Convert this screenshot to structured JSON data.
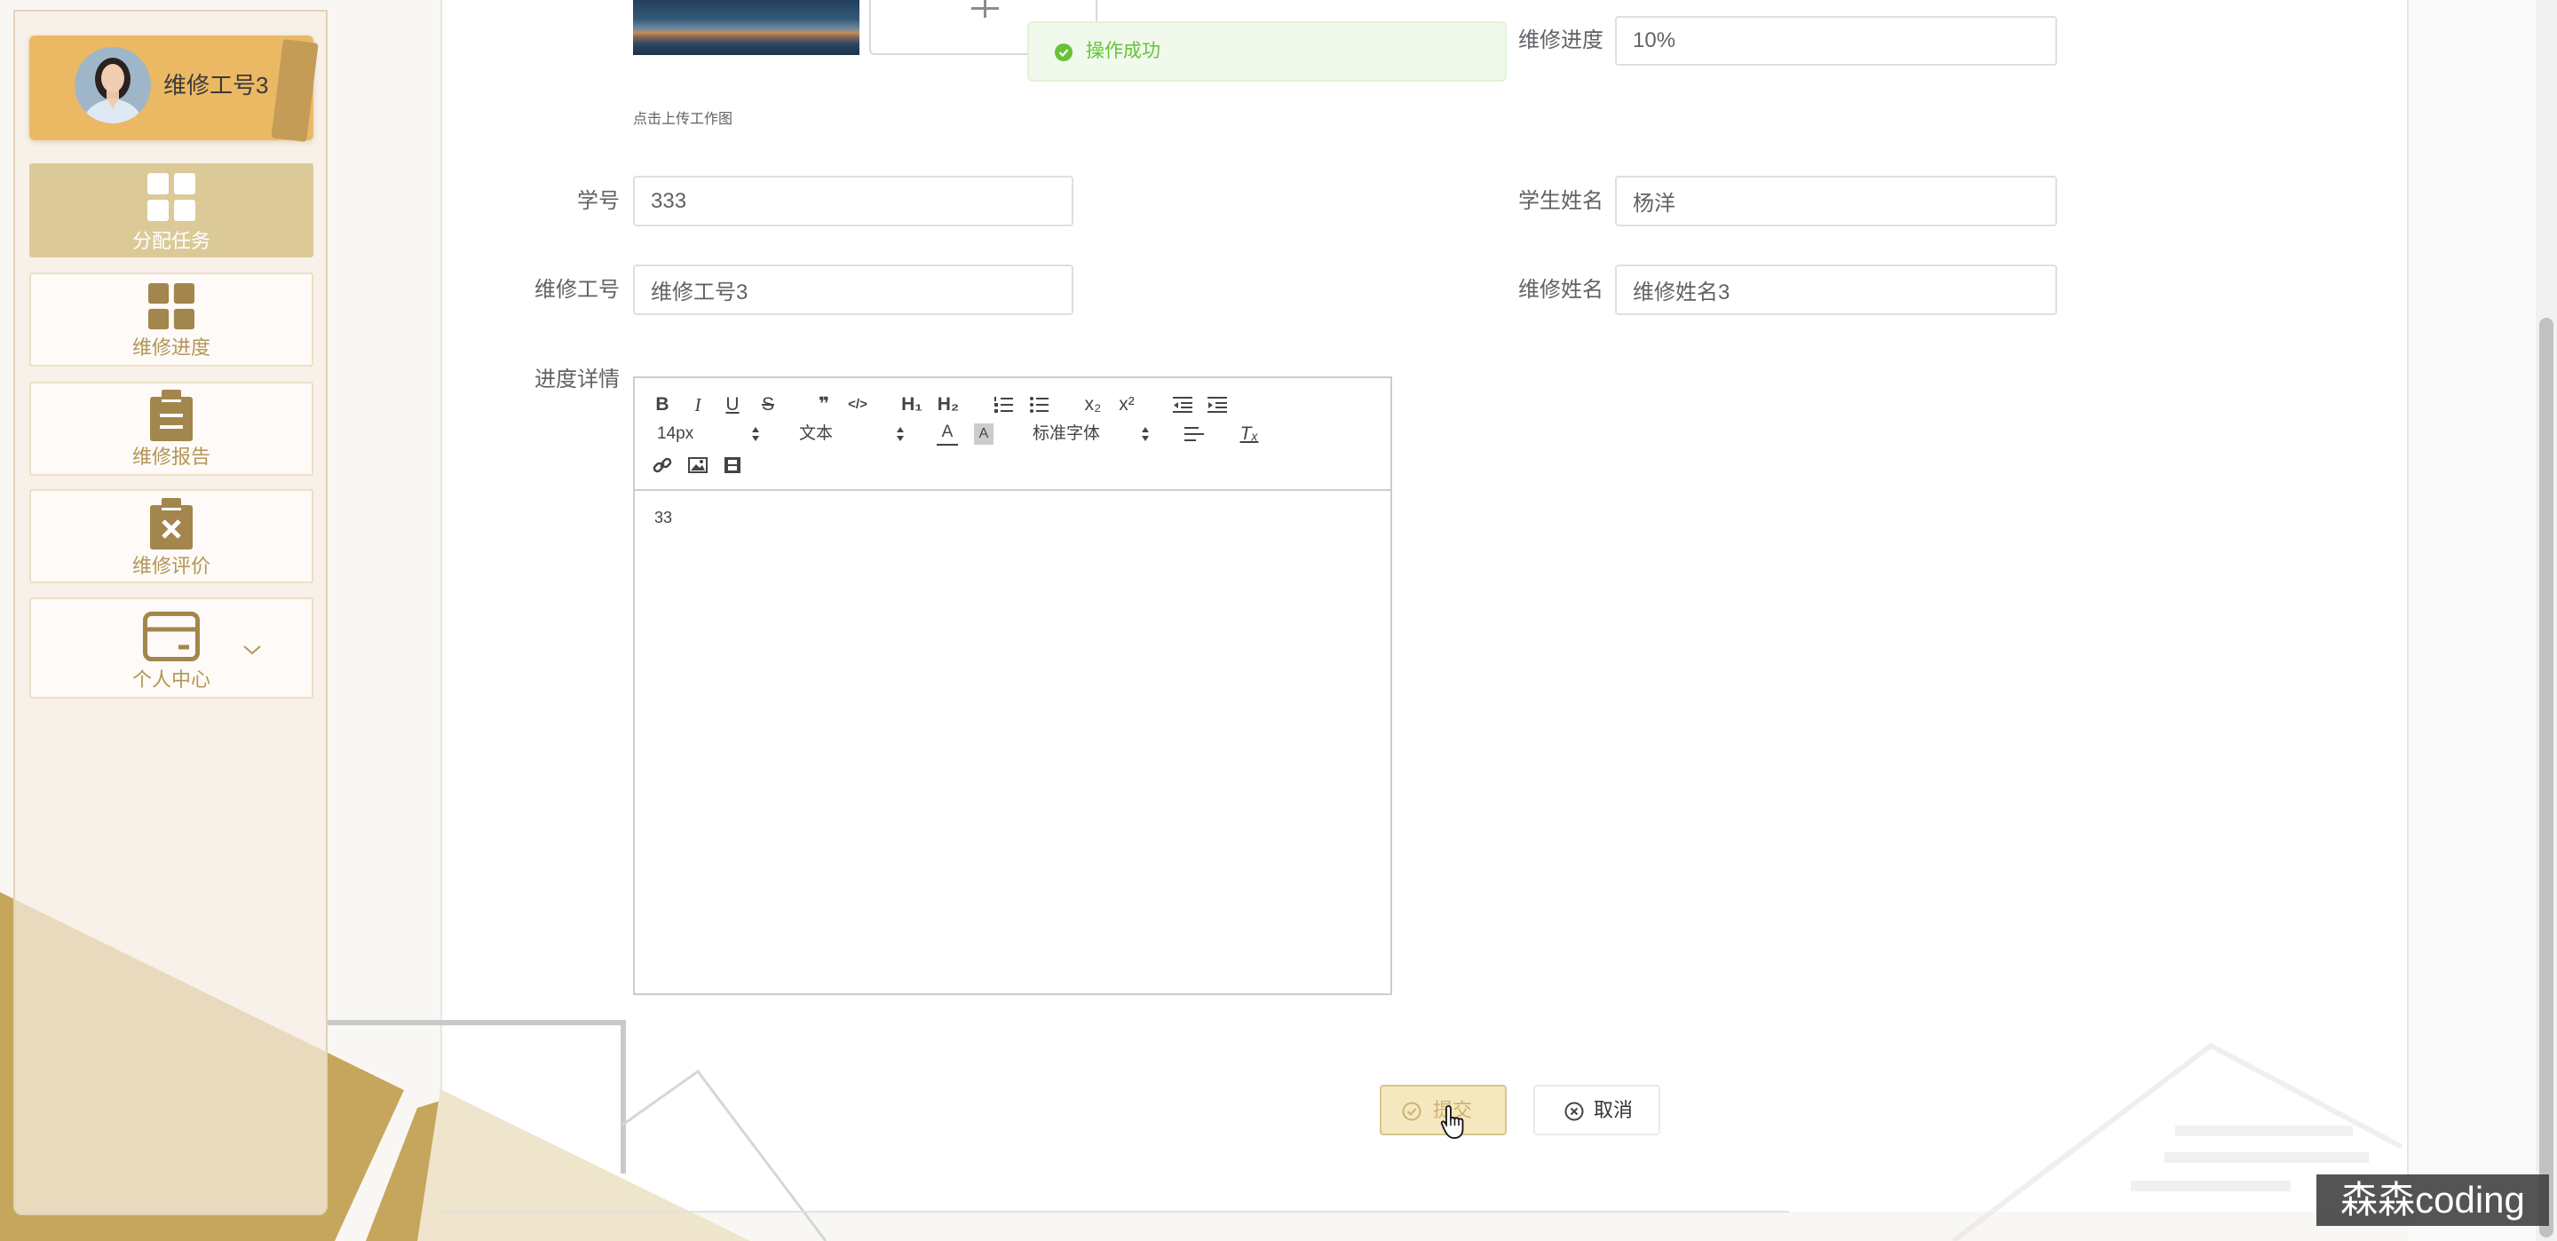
{
  "user": {
    "name": "维修工号3",
    "avatar_icon": "avatar"
  },
  "sidebar": {
    "items": [
      {
        "label": "分配任务",
        "icon": "grid-icon",
        "active": true
      },
      {
        "label": "维修进度",
        "icon": "grid-icon",
        "active": false
      },
      {
        "label": "维修报告",
        "icon": "clipboard-icon",
        "active": false
      },
      {
        "label": "维修评价",
        "icon": "clipboard-x-icon",
        "active": false
      },
      {
        "label": "个人中心",
        "icon": "card-icon",
        "active": false,
        "submenu_icon": "chevron-down-icon"
      }
    ]
  },
  "toast": {
    "type": "success",
    "icon": "check-circle-icon",
    "message": "操作成功"
  },
  "form": {
    "upload": {
      "hint": "点击上传工作图",
      "add_icon": "plus-icon"
    },
    "progress": {
      "label": "维修进度",
      "value": "10%"
    },
    "student_id": {
      "label": "学号",
      "value": "333"
    },
    "student_name": {
      "label": "学生姓名",
      "value": "杨洋"
    },
    "worker_id": {
      "label": "维修工号",
      "value": "维修工号3"
    },
    "worker_name": {
      "label": "维修姓名",
      "value": "维修姓名3"
    },
    "detail": {
      "label": "进度详情",
      "content": "33"
    }
  },
  "editor": {
    "glyphs": {
      "bold": "B",
      "italic": "I",
      "underline": "U",
      "strike": "S",
      "blockquote": "❞",
      "code": "</>",
      "h1": "H₁",
      "h2": "H₂",
      "subscript": "x₂",
      "superscript": "x²",
      "font_color": "A",
      "background_color": "A",
      "clean": "Tₓ"
    },
    "icons": [
      "ordered-list-icon",
      "bullet-list-icon",
      "outdent-icon",
      "indent-icon",
      "align-icon",
      "link-icon",
      "image-icon",
      "video-icon"
    ],
    "font_size": "14px",
    "header": "文本",
    "font_family": "标准字体"
  },
  "buttons": {
    "submit": "提交",
    "submit_icon": "check-circle-icon",
    "cancel": "取消",
    "cancel_icon": "x-circle-icon"
  },
  "watermark": "森森coding",
  "colors": {
    "profile_card": "#ebb964",
    "active_menu": "#dbca98",
    "menu_icon": "#a3864c",
    "success": "#67c23a",
    "submit_button": "#f6e8be",
    "decoration_gold": "#c6a65c"
  }
}
